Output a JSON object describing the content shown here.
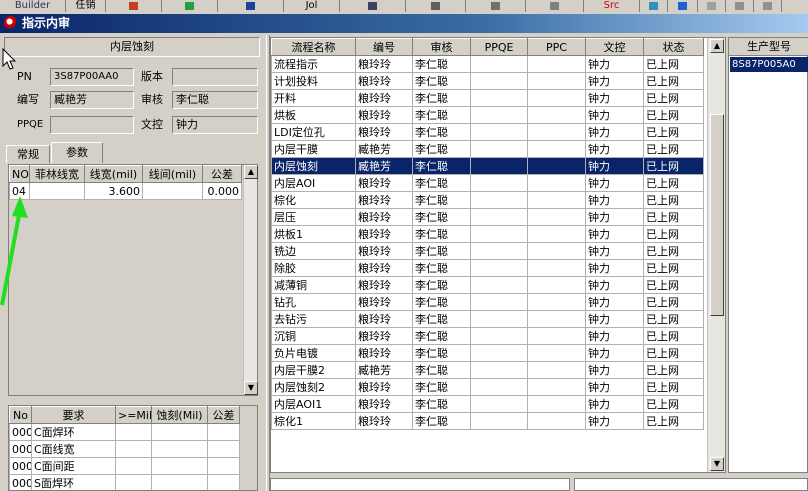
{
  "toolbar": {
    "items": [
      "Builder",
      "任销",
      "",
      "",
      "",
      "Jol",
      "",
      "",
      "",
      "",
      "Src",
      "",
      "",
      "",
      "",
      ""
    ]
  },
  "window": {
    "title": "指示内审"
  },
  "left": {
    "header": "内层蚀刻",
    "pn_label": "PN",
    "pn_value": "3S87P00AA0",
    "version_label": "版本",
    "version_value": "",
    "author_label": "编写",
    "author_value": "臧艳芳",
    "review_label": "审核",
    "review_value": "李仁聪",
    "ppqe_label": "PPQE",
    "ppqe_value": "",
    "doc_label": "文控",
    "doc_value": "钟力",
    "tabs": [
      "常规",
      "参数"
    ],
    "param_table": {
      "headers": [
        "NO.",
        "菲林线宽",
        "线宽(mil)",
        "线间(mil)",
        "公差"
      ],
      "rows": [
        [
          "04",
          "",
          "3.600",
          "",
          "0.000"
        ]
      ]
    },
    "bottom_table": {
      "headers": [
        "No",
        "要求",
        ">=Mil",
        "蚀刻(Mil)",
        "公差"
      ],
      "rows": [
        [
          "000",
          "C面焊环",
          "",
          "",
          ""
        ],
        [
          "000",
          "C面线宽",
          "",
          "",
          ""
        ],
        [
          "000",
          "C面间距",
          "",
          "",
          ""
        ],
        [
          "000",
          "S面焊环",
          "",
          "",
          ""
        ]
      ]
    }
  },
  "main": {
    "headers": [
      "流程名称",
      "编号",
      "审核",
      "PPQE",
      "PPC",
      "文控",
      "状态"
    ],
    "rows": [
      [
        "流程指示",
        "粮玲玲",
        "李仁聪",
        "",
        "",
        "钟力",
        "已上网"
      ],
      [
        "计划投料",
        "粮玲玲",
        "李仁聪",
        "",
        "",
        "钟力",
        "已上网"
      ],
      [
        "开料",
        "粮玲玲",
        "李仁聪",
        "",
        "",
        "钟力",
        "已上网"
      ],
      [
        "烘板",
        "粮玲玲",
        "李仁聪",
        "",
        "",
        "钟力",
        "已上网"
      ],
      [
        "LDI定位孔",
        "粮玲玲",
        "李仁聪",
        "",
        "",
        "钟力",
        "已上网"
      ],
      [
        "内层干膜",
        "臧艳芳",
        "李仁聪",
        "",
        "",
        "钟力",
        "已上网"
      ],
      [
        "内层蚀刻",
        "臧艳芳",
        "李仁聪",
        "",
        "",
        "钟力",
        "已上网"
      ],
      [
        "内层AOI",
        "粮玲玲",
        "李仁聪",
        "",
        "",
        "钟力",
        "已上网"
      ],
      [
        "棕化",
        "粮玲玲",
        "李仁聪",
        "",
        "",
        "钟力",
        "已上网"
      ],
      [
        "层压",
        "粮玲玲",
        "李仁聪",
        "",
        "",
        "钟力",
        "已上网"
      ],
      [
        "烘板1",
        "粮玲玲",
        "李仁聪",
        "",
        "",
        "钟力",
        "已上网"
      ],
      [
        "铣边",
        "粮玲玲",
        "李仁聪",
        "",
        "",
        "钟力",
        "已上网"
      ],
      [
        "除胶",
        "粮玲玲",
        "李仁聪",
        "",
        "",
        "钟力",
        "已上网"
      ],
      [
        "减薄铜",
        "粮玲玲",
        "李仁聪",
        "",
        "",
        "钟力",
        "已上网"
      ],
      [
        "钻孔",
        "粮玲玲",
        "李仁聪",
        "",
        "",
        "钟力",
        "已上网"
      ],
      [
        "去钻污",
        "粮玲玲",
        "李仁聪",
        "",
        "",
        "钟力",
        "已上网"
      ],
      [
        "沉铜",
        "粮玲玲",
        "李仁聪",
        "",
        "",
        "钟力",
        "已上网"
      ],
      [
        "负片电镀",
        "粮玲玲",
        "李仁聪",
        "",
        "",
        "钟力",
        "已上网"
      ],
      [
        "内层干膜2",
        "臧艳芳",
        "李仁聪",
        "",
        "",
        "钟力",
        "已上网"
      ],
      [
        "内层蚀刻2",
        "粮玲玲",
        "李仁聪",
        "",
        "",
        "钟力",
        "已上网"
      ],
      [
        "内层AOI1",
        "粮玲玲",
        "李仁聪",
        "",
        "",
        "钟力",
        "已上网"
      ],
      [
        "棕化1",
        "粮玲玲",
        "李仁聪",
        "",
        "",
        "钟力",
        "已上网"
      ]
    ],
    "selected_row": 6
  },
  "right": {
    "header": "生产型号",
    "items": [
      "8S87P005A0"
    ]
  },
  "colors": {
    "selection": "#0a246a",
    "title_start": "#0a246a",
    "arrow": "#22dd22"
  }
}
